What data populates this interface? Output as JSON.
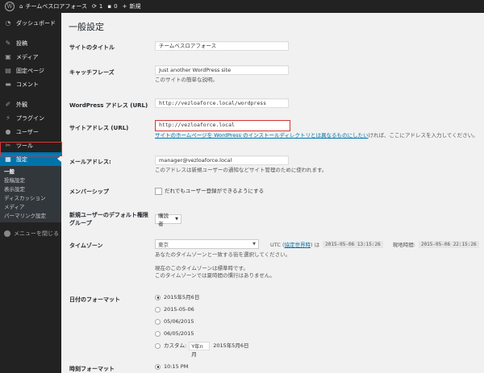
{
  "adminbar": {
    "site_name": "チームベスロアフォース",
    "updates_count": "1",
    "comments_count": "0",
    "new_label": "新規"
  },
  "sidebar": {
    "dashboard": "ダッシュボード",
    "posts": "投稿",
    "media": "メディア",
    "pages": "固定ページ",
    "comments": "コメント",
    "appearance": "外観",
    "plugins": "プラグイン",
    "users": "ユーザー",
    "tools": "ツール",
    "settings": "設定",
    "submenu": [
      "一般",
      "投稿設定",
      "表示設定",
      "ディスカッション",
      "メディア",
      "パーマリンク設定"
    ],
    "collapse": "メニューを閉じる"
  },
  "page": {
    "title": "一般設定",
    "site_title_label": "サイトのタイトル",
    "site_title_value": "チームベスロアフォース",
    "tagline_label": "キャッチフレーズ",
    "tagline_value": "Just another WordPress site",
    "tagline_desc": "このサイトの簡単な説明。",
    "wp_address_label": "WordPress アドレス (URL)",
    "wp_address_value": "http://vezloaforce.local/wordpress",
    "site_address_label": "サイトアドレス (URL)",
    "site_address_value": "http://vezloaforce.local",
    "site_address_desc_link": "サイトのホームページを WordPress のインストールディレクトリとは異なるものにしたい",
    "site_address_desc_rest": "ければ、ここにアドレスを入力してください。",
    "email_label": "メールアドレス:",
    "email_value": "manager@vezloaforce.local",
    "email_desc": "このアドレスは新規ユーザーの通知などサイト管理のために使われます。",
    "membership_label": "メンバーシップ",
    "membership_checkbox": "だれでもユーザー登録ができるようにする",
    "default_role_label_1": "新規ユーザーのデフォルト権限",
    "default_role_label_2": "グループ",
    "default_role_value": "購読者",
    "timezone_label": "タイムゾーン",
    "timezone_value": "東京",
    "utc_prefix": "UTC (",
    "utc_link": "協定世界時",
    "utc_suffix": ") は",
    "utc_time": "2015-05-06 13:15:26",
    "local_label": "現地時間:",
    "local_time": "2015-05-06 22:15:26",
    "timezone_desc": "あなたのタイムゾーンと一致する街を選択してください。",
    "dst_line1": "現在のこのタイムゾーンは標準時です。",
    "dst_line2": "このタイムゾーンでは夏時間の慣行はありません。",
    "date_format_label": "日付のフォーマット",
    "date_options": [
      "2015年5月6日",
      "2015-05-06",
      "05/06/2015",
      "06/05/2015"
    ],
    "custom_label": "カスタム:",
    "custom_format": "Y年n月",
    "custom_preview": "2015年5月6日",
    "time_format_label": "時刻フォーマット",
    "time_option_1": "10:15 PM"
  },
  "colors": {
    "sidebar_bg": "#222222",
    "active_bg": "#0073aa",
    "highlight_red": "#d63638",
    "link": "#0073aa"
  }
}
